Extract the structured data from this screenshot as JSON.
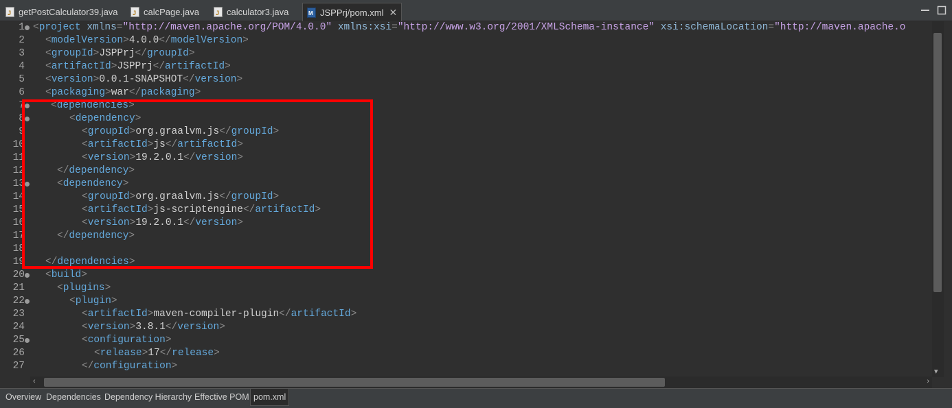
{
  "tabs": [
    {
      "label": "getPostCalculator39.java",
      "icon": "java-file-icon"
    },
    {
      "label": "calcPage.java",
      "icon": "java-file-icon"
    },
    {
      "label": "calculator3.java",
      "icon": "java-file-icon"
    },
    {
      "label": "JSPPrj/pom.xml",
      "icon": "maven-pom-icon",
      "active": true
    }
  ],
  "editor": {
    "line_numbers": [
      "1",
      "2",
      "3",
      "4",
      "5",
      "6",
      "7",
      "8",
      "9",
      "10",
      "11",
      "12",
      "13",
      "14",
      "15",
      "16",
      "17",
      "18",
      "19",
      "20",
      "21",
      "22",
      "23",
      "24",
      "25",
      "26",
      "27"
    ],
    "lines": {
      "l1": {
        "tag": "project",
        "attrs": [
          [
            "xmlns",
            "\"http://maven.apache.org/POM/4.0.0\""
          ],
          [
            "xmlns:xsi",
            "\"http://www.w3.org/2001/XMLSchema-instance\""
          ],
          [
            "xsi:schemaLocation",
            "\"http://maven.apache.o"
          ]
        ]
      },
      "l2": {
        "tag": "modelVersion",
        "text": "4.0.0"
      },
      "l3": {
        "tag": "groupId",
        "text": "JSPPrj"
      },
      "l4": {
        "tag": "artifactId",
        "text": "JSPPrj"
      },
      "l5": {
        "tag": "version",
        "text": "0.0.1-SNAPSHOT"
      },
      "l6": {
        "tag": "packaging",
        "text": "war"
      },
      "l7": {
        "tag": "dependencies"
      },
      "l8": {
        "tag": "dependency"
      },
      "l9": {
        "tag": "groupId",
        "text": "org.graalvm.js"
      },
      "l10": {
        "tag": "artifactId",
        "text": "js"
      },
      "l11": {
        "tag": "version",
        "text": "19.2.0.1"
      },
      "l12": {
        "tag": "dependency"
      },
      "l13": {
        "tag": "dependency"
      },
      "l14": {
        "tag": "groupId",
        "text": "org.graalvm.js"
      },
      "l15": {
        "tag": "artifactId",
        "text": "js-scriptengine"
      },
      "l16": {
        "tag": "version",
        "text": "19.2.0.1"
      },
      "l17": {
        "tag": "dependency"
      },
      "l19": {
        "tag": "dependencies"
      },
      "l20": {
        "tag": "build"
      },
      "l21": {
        "tag": "plugins"
      },
      "l22": {
        "tag": "plugin"
      },
      "l23": {
        "tag": "artifactId",
        "text": "maven-compiler-plugin"
      },
      "l24": {
        "tag": "version",
        "text": "3.8.1"
      },
      "l25": {
        "tag": "configuration"
      },
      "l26": {
        "tag": "release",
        "text": "17"
      },
      "l27": {
        "tag": "configuration"
      }
    }
  },
  "bottom_tabs": [
    "Overview",
    "Dependencies",
    "Dependency Hierarchy",
    "Effective POM",
    "pom.xml"
  ],
  "colors": {
    "highlight": "#ff0000",
    "tag": "#64a9dc",
    "bracket": "#8a8a8a",
    "attr_value": "#c7a2e6"
  }
}
